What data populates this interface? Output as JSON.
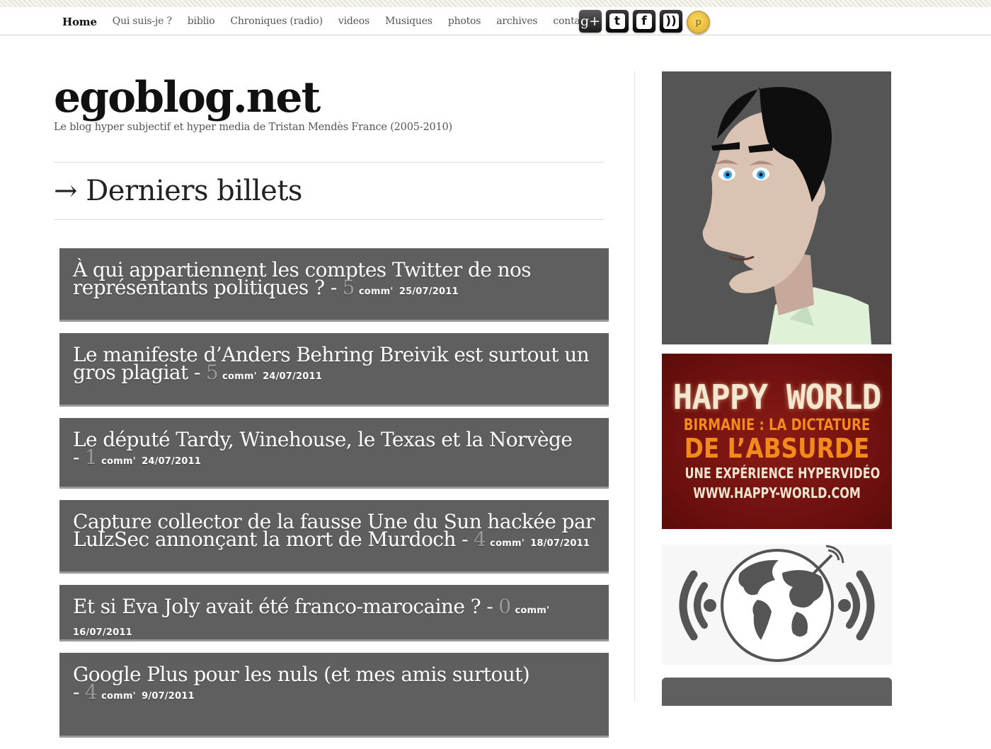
{
  "nav": {
    "items": [
      "Home",
      "Qui suis-je ?",
      "biblio",
      "Chroniques (radio)",
      "videos",
      "Musiques",
      "photos",
      "archives",
      "contact"
    ],
    "active_index": 0
  },
  "social": {
    "icons": [
      {
        "name": "google-plus-icon",
        "glyph": "g+"
      },
      {
        "name": "twitter-icon",
        "glyph": "t"
      },
      {
        "name": "facebook-icon",
        "glyph": "f"
      },
      {
        "name": "rss-icon",
        "glyph": "))"
      },
      {
        "name": "p-coin-icon",
        "glyph": "p"
      }
    ]
  },
  "header": {
    "title": "egoblog.net",
    "tagline": "Le blog hyper subjectif et hyper media de Tristan Mendès France (2005-2010)"
  },
  "section": {
    "heading": "→ Derniers billets"
  },
  "posts": [
    {
      "title": "À qui appartiennent les comptes Twitter de nos représentants politiques ?",
      "sep": "-",
      "count": "5",
      "comm": "comm'",
      "date": "25/07/2011"
    },
    {
      "title": "Le manifeste d’Anders Behring Breivik est surtout un gros plagiat",
      "sep": "-",
      "count": "5",
      "comm": "comm'",
      "date": "24/07/2011"
    },
    {
      "title": "Le député Tardy, Winehouse, le Texas et la Norvège",
      "sep": "-",
      "count": "1",
      "comm": "comm'",
      "date": "24/07/2011"
    },
    {
      "title": "Capture collector de la fausse Une du Sun hackée par LulzSec annonçant la mort de Murdoch",
      "sep": "-",
      "count": "4",
      "comm": "comm'",
      "date": "18/07/2011"
    },
    {
      "title": "Et si Eva Joly avait été franco-marocaine ?",
      "sep": "-",
      "count": "0",
      "comm": "comm'",
      "date": "16/07/2011"
    },
    {
      "title": "Google Plus pour les nuls (et mes amis surtout)",
      "sep": "-",
      "count": "4",
      "comm": "comm'",
      "date": "9/07/2011"
    }
  ],
  "sidebar": {
    "happy_world": {
      "title": "HAPPY WORLD",
      "subtitle": "BIRMANIE : LA DICTATURE",
      "big": "DE L’ABSURDE",
      "line1": "UNE EXPÉRIENCE HYPERVIDÉO",
      "line2": "WWW.HAPPY-WORLD.COM"
    }
  },
  "colors": {
    "post_bg": "#5f5f5f",
    "happy_bg": "#7a1410",
    "happy_orange": "#f58a1c"
  }
}
